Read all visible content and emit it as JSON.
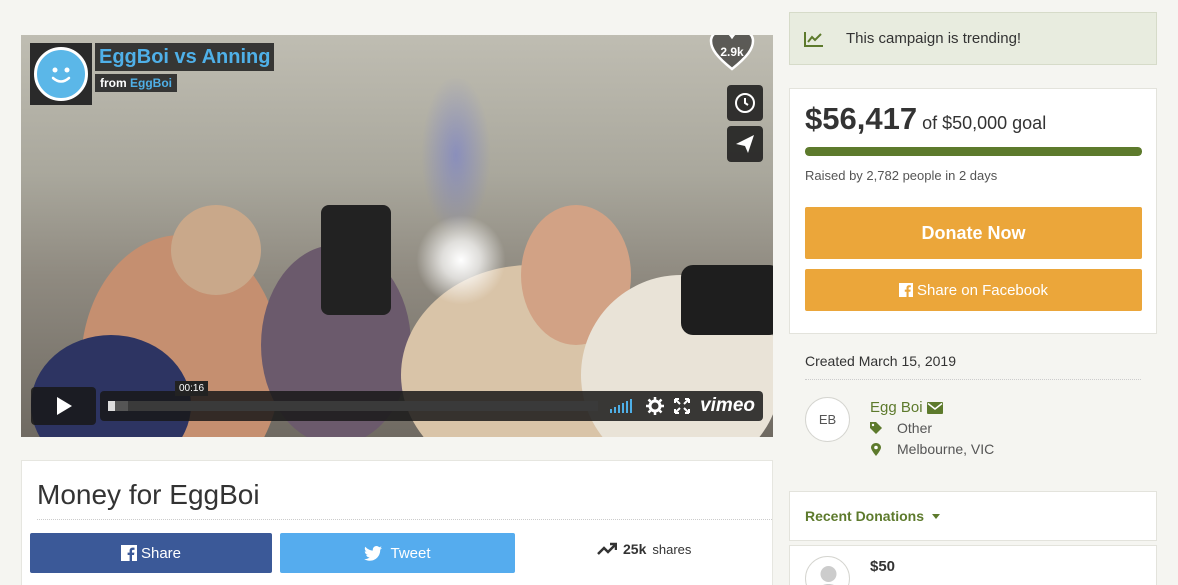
{
  "video": {
    "title": "EggBoi vs Anning",
    "from_label": "from",
    "from_user": "EggBoi",
    "likes": "2.9k",
    "current_time": "00:16",
    "progress_fraction": 0.015,
    "buffer_fraction": 0.04,
    "player_brand": "vimeo"
  },
  "campaign": {
    "title": "Money for EggBoi",
    "share_label": "Share",
    "tweet_label": "Tweet",
    "shares_count": "25k",
    "shares_label": "shares"
  },
  "sidebar": {
    "trending_text": "This campaign is trending!",
    "raised_amount": "$56,417",
    "goal_text": "of $50,000 goal",
    "progress_fraction": 1.0,
    "raised_by": "Raised by 2,782 people in 2 days",
    "donate_label": "Donate Now",
    "fb_share_label": "Share on Facebook",
    "created": "Created March 15, 2019",
    "organizer": {
      "initials": "EB",
      "name": "Egg Boi",
      "category": "Other",
      "location": "Melbourne, VIC"
    },
    "recent_donations_label": "Recent Donations",
    "donations": [
      {
        "amount": "$50"
      }
    ]
  },
  "colors": {
    "brand_green": "#5d7a2c",
    "donate_orange": "#eba63a",
    "facebook_blue": "#3b5998",
    "twitter_blue": "#55acee"
  }
}
